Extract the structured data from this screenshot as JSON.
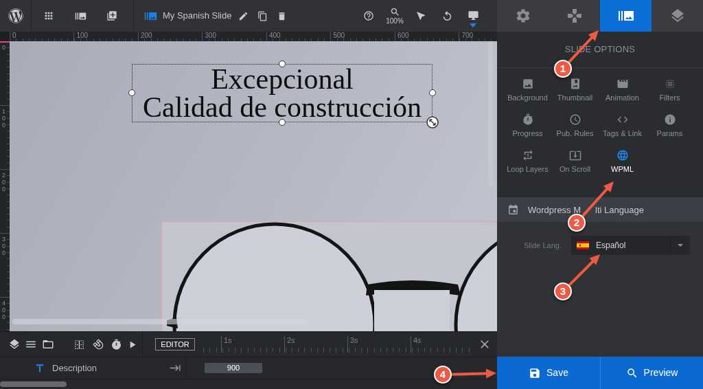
{
  "toolbar": {
    "slide_title": "My Spanish Slide",
    "zoom_level": "100%"
  },
  "rulers": {
    "horizontal": [
      "0",
      "100",
      "200",
      "300",
      "400",
      "500",
      "600",
      "700"
    ],
    "vertical": [
      "0",
      "100",
      "200",
      "300",
      "400"
    ]
  },
  "canvas": {
    "layer": {
      "lines": [
        "Excepcional",
        "Calidad de construcción"
      ],
      "selected": true
    }
  },
  "timeline": {
    "mode_button": "EDITOR",
    "ticks": [
      "1s",
      "2s",
      "3s",
      "4s"
    ],
    "layers": [
      {
        "kind": "text",
        "name": "Description",
        "duration": "900"
      }
    ]
  },
  "panel": {
    "tabs": [
      {
        "kind": "settings",
        "selected": false
      },
      {
        "kind": "navigation",
        "selected": false
      },
      {
        "kind": "slides",
        "selected": true
      },
      {
        "kind": "layers",
        "selected": false
      }
    ],
    "title": "SLIDE OPTIONS",
    "options": [
      {
        "kind": "background",
        "label": "Background",
        "selected": false
      },
      {
        "kind": "thumbnail",
        "label": "Thumbnail",
        "selected": false
      },
      {
        "kind": "animation",
        "label": "Animation",
        "selected": false
      },
      {
        "kind": "filters",
        "label": "Filters",
        "selected": false
      },
      {
        "kind": "progress",
        "label": "Progress",
        "selected": false
      },
      {
        "kind": "rules",
        "label": "Pub. Rules",
        "selected": false
      },
      {
        "kind": "tags",
        "label": "Tags & Link",
        "selected": false
      },
      {
        "kind": "params",
        "label": "Params",
        "selected": false
      },
      {
        "kind": "loop",
        "label": "Loop Layers",
        "selected": false
      },
      {
        "kind": "scroll",
        "label": "On Scroll",
        "selected": false
      },
      {
        "kind": "wpml",
        "label": "WPML",
        "selected": true
      }
    ],
    "section": {
      "title_parts": [
        "Wordpress M",
        "lti Language"
      ],
      "fields": [
        {
          "kind": "language",
          "label": "Slide Lang.",
          "value": "Español"
        }
      ]
    },
    "buttons": [
      {
        "kind": "save",
        "label": "Save"
      },
      {
        "kind": "preview",
        "label": "Preview"
      }
    ]
  },
  "callouts": [
    {
      "number": "1"
    },
    {
      "number": "2"
    },
    {
      "number": "3"
    },
    {
      "number": "4"
    }
  ]
}
